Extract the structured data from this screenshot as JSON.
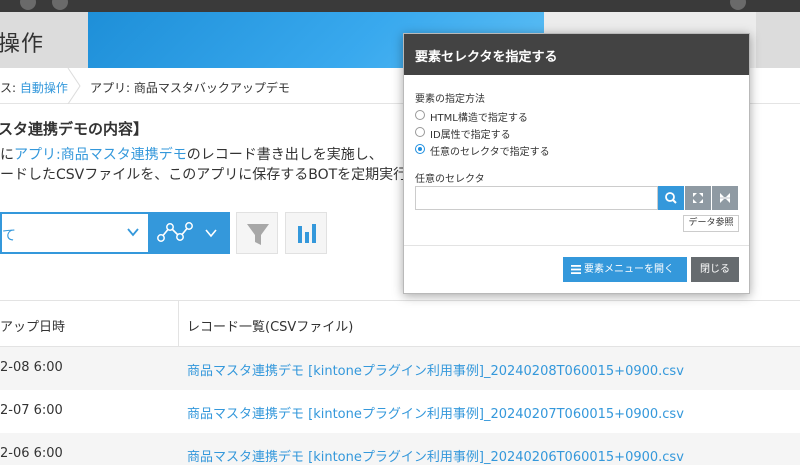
{
  "header": {
    "title": "操作"
  },
  "breadcrumb": {
    "prefix": "ス: ",
    "link": "自動操作",
    "current": "アプリ: 商品マスタバックアップデモ"
  },
  "description": {
    "heading": "スタ連携デモの内容】",
    "line1_prefix": "に",
    "line1_link": "アプリ:商品マスタ連携デモ",
    "line1_suffix": "のレコード書き出しを実施し、",
    "line2": "ードしたCSVファイルを、このアプリに保存するBOTを定期実行し"
  },
  "toolbar": {
    "view_value": "て"
  },
  "table": {
    "columns": [
      "アップ日時",
      "レコード一覧(CSVファイル)"
    ],
    "rows": [
      {
        "date": "2-08 6:00",
        "file": "商品マスタ連携デモ [kintoneプラグイン利用事例]_20240208T060015+0900.csv"
      },
      {
        "date": "2-07 6:00",
        "file": "商品マスタ連携デモ [kintoneプラグイン利用事例]_20240207T060015+0900.csv"
      },
      {
        "date": "2-06 6:00",
        "file": "商品マスタ連携デモ [kintoneプラグイン利用事例]_20240206T060015+0900.csv"
      }
    ]
  },
  "modal": {
    "title": "要素セレクタを指定する",
    "method_label": "要素の指定方法",
    "options": [
      {
        "label": "HTML構造で指定する",
        "selected": false
      },
      {
        "label": "ID属性で指定する",
        "selected": false
      },
      {
        "label": "任意のセレクタで指定する",
        "selected": true
      }
    ],
    "selector_label": "任意のセレクタ",
    "selector_value": "",
    "data_ref_label": "データ参照",
    "open_menu_label": "要素メニューを開く",
    "close_label": "閉じる"
  },
  "colors": {
    "accent": "#3498db",
    "modal_header": "#434343",
    "banner": "#2196e0"
  }
}
